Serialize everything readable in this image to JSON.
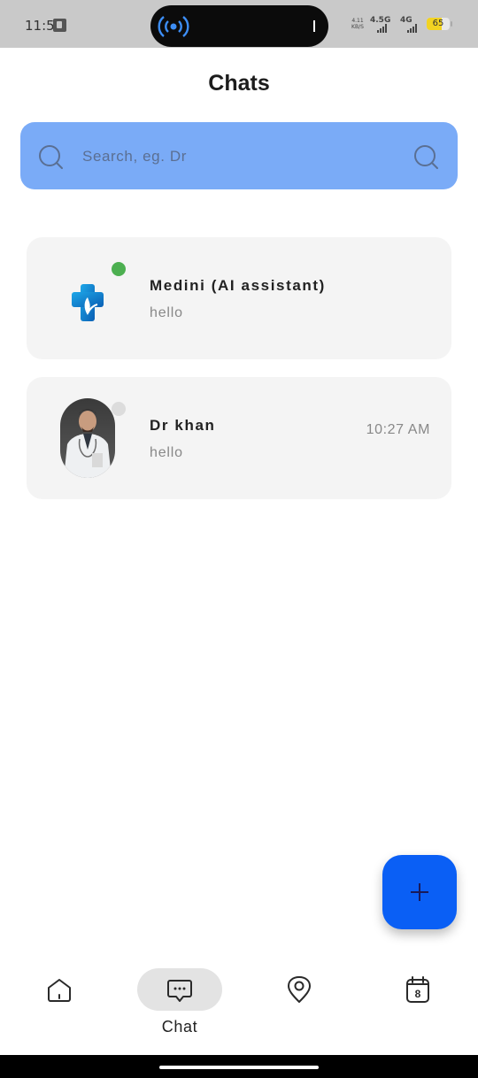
{
  "status_bar": {
    "time": "11:54",
    "net_speed_top": "4.11",
    "net_speed_bottom": "KB/S",
    "sim1_label": "4.5G",
    "sim2_label": "4G",
    "battery_level": "65",
    "battery_fraction": 0.65,
    "icons": [
      "app-notification-icon",
      "broadcast-icon",
      "signal-icon",
      "battery-icon"
    ]
  },
  "header": {
    "title": "Chats"
  },
  "search": {
    "placeholder": "Search, eg. Dr",
    "value": ""
  },
  "chats": [
    {
      "name": "Medini (AI assistant)",
      "preview": "hello",
      "time": "",
      "online": true,
      "avatar_icon": "medical-cross-logo-icon"
    },
    {
      "name": "Dr khan",
      "preview": "hello",
      "time": "10:27 AM",
      "online": false,
      "avatar_icon": "doctor-photo"
    }
  ],
  "fab": {
    "icon": "plus-icon"
  },
  "bottom_nav": {
    "items": [
      {
        "icon": "home-icon",
        "label": "",
        "active": false
      },
      {
        "icon": "chat-icon",
        "label": "Chat",
        "active": true
      },
      {
        "icon": "location-pin-icon",
        "label": "",
        "active": false
      },
      {
        "icon": "calendar-icon",
        "label": "",
        "badge": "8",
        "active": false
      }
    ]
  },
  "colors": {
    "search_bg": "#7aabf7",
    "fab_bg": "#0a5ff5",
    "online_dot": "#4caf50",
    "offline_dot": "#dcdcdc",
    "card_bg": "#f4f4f4"
  }
}
